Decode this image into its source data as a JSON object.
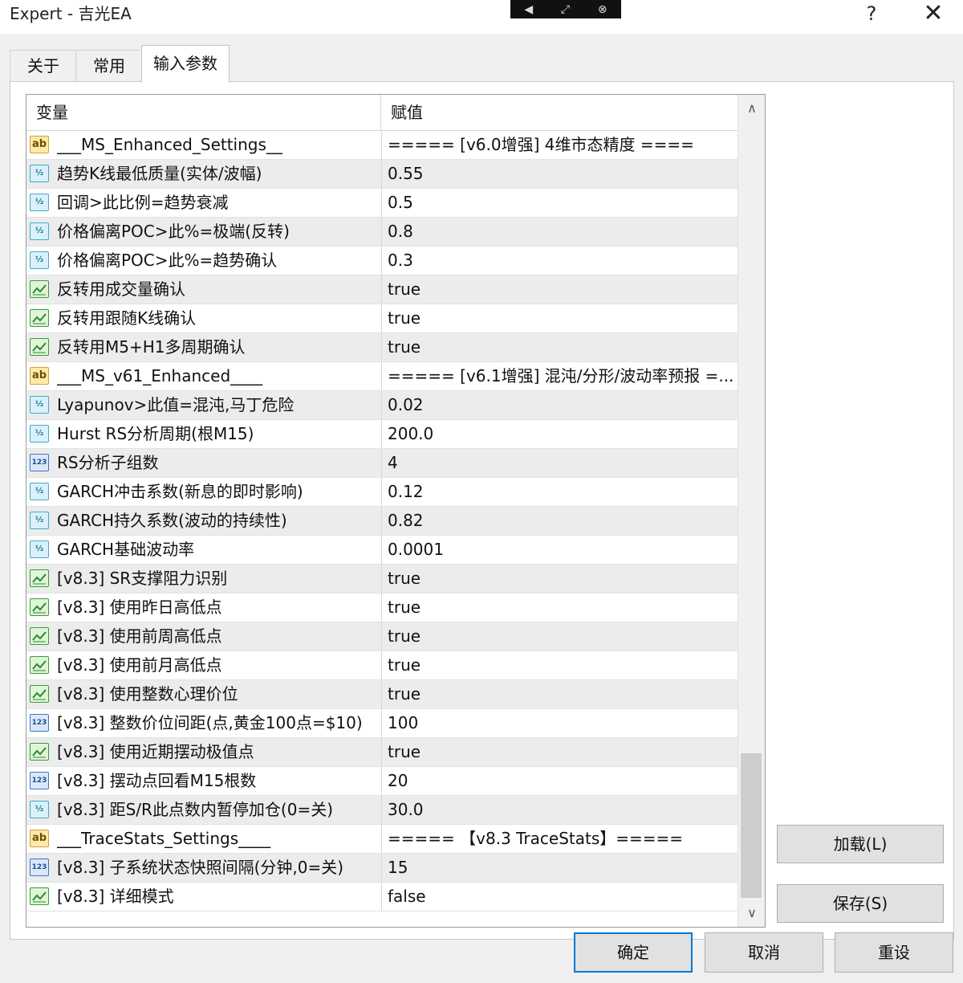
{
  "window": {
    "title": "Expert - 吉光EA",
    "help_glyph": "?",
    "close_glyph": "✕"
  },
  "tabs": [
    {
      "label": "关于"
    },
    {
      "label": "常用"
    },
    {
      "label": "输入参数"
    }
  ],
  "grid": {
    "header_variable": "变量",
    "header_value": "赋值",
    "rows": [
      {
        "icon": "ab",
        "name": "___MS_Enhanced_Settings__",
        "value": "===== [v6.0增强] 4维市态精度 ===="
      },
      {
        "icon": "double",
        "name": "趋势K线最低质量(实体/波幅)",
        "value": "0.55"
      },
      {
        "icon": "double",
        "name": "回调>此比例=趋势衰减",
        "value": "0.5"
      },
      {
        "icon": "double",
        "name": "价格偏离POC>此%=极端(反转)",
        "value": "0.8"
      },
      {
        "icon": "double",
        "name": "价格偏离POC>此%=趋势确认",
        "value": "0.3"
      },
      {
        "icon": "bool",
        "name": "反转用成交量确认",
        "value": "true"
      },
      {
        "icon": "bool",
        "name": "反转用跟随K线确认",
        "value": "true"
      },
      {
        "icon": "bool",
        "name": "反转用M5+H1多周期确认",
        "value": "true"
      },
      {
        "icon": "ab",
        "name": "___MS_v61_Enhanced____",
        "value": "===== [v6.1增强] 混沌/分形/波动率预报 =..."
      },
      {
        "icon": "double",
        "name": "Lyapunov>此值=混沌,马丁危险",
        "value": "0.02"
      },
      {
        "icon": "double",
        "name": "Hurst RS分析周期(根M15)",
        "value": "200.0"
      },
      {
        "icon": "int",
        "name": "RS分析子组数",
        "value": "4"
      },
      {
        "icon": "double",
        "name": "GARCH冲击系数(新息的即时影响)",
        "value": "0.12"
      },
      {
        "icon": "double",
        "name": "GARCH持久系数(波动的持续性)",
        "value": "0.82"
      },
      {
        "icon": "double",
        "name": "GARCH基础波动率",
        "value": "0.0001"
      },
      {
        "icon": "bool",
        "name": "[v8.3] SR支撑阻力识别",
        "value": "true"
      },
      {
        "icon": "bool",
        "name": "[v8.3] 使用昨日高低点",
        "value": "true"
      },
      {
        "icon": "bool",
        "name": "[v8.3] 使用前周高低点",
        "value": "true"
      },
      {
        "icon": "bool",
        "name": "[v8.3] 使用前月高低点",
        "value": "true"
      },
      {
        "icon": "bool",
        "name": "[v8.3] 使用整数心理价位",
        "value": "true"
      },
      {
        "icon": "int",
        "name": "[v8.3] 整数价位间距(点,黄金100点=$10)",
        "value": "100"
      },
      {
        "icon": "bool",
        "name": "[v8.3] 使用近期摆动极值点",
        "value": "true"
      },
      {
        "icon": "int",
        "name": "[v8.3] 摆动点回看M15根数",
        "value": "20"
      },
      {
        "icon": "double",
        "name": "[v8.3] 距S/R此点数内暂停加仓(0=关)",
        "value": "30.0"
      },
      {
        "icon": "ab",
        "name": "___TraceStats_Settings____",
        "value": "===== 【v8.3 TraceStats】====="
      },
      {
        "icon": "int",
        "name": "[v8.3] 子系统状态快照间隔(分钟,0=关)",
        "value": "15"
      },
      {
        "icon": "bool",
        "name": "[v8.3] 详细模式",
        "value": "false"
      }
    ]
  },
  "buttons": {
    "load": "加载(L)",
    "save": "保存(S)",
    "ok": "确定",
    "cancel": "取消",
    "reset": "重设"
  },
  "icon_text": {
    "ab": "ab",
    "double": "½",
    "int": "123"
  }
}
